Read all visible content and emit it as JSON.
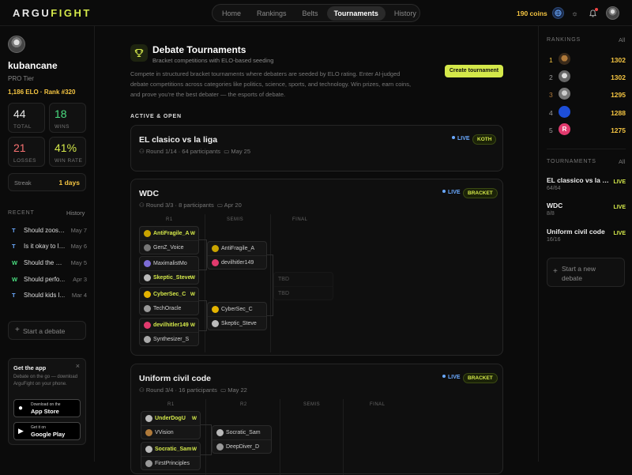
{
  "app": {
    "logo_a": "ARGU",
    "logo_b": "FIGHT"
  },
  "nav": {
    "items": [
      "Home",
      "Rankings",
      "Belts",
      "Tournaments",
      "History"
    ],
    "active": "Tournaments"
  },
  "top": {
    "coins": "190 coins"
  },
  "profile": {
    "username": "kubancane",
    "tier": "PRO Tier",
    "elo": "1,186 ELO",
    "sep": "·",
    "rank": "Rank #320",
    "stats": [
      {
        "value": "44",
        "label": "TOTAL",
        "color": "#e6e6e6"
      },
      {
        "value": "18",
        "label": "WINS",
        "color": "#4ade80"
      },
      {
        "value": "21",
        "label": "LOSSES",
        "color": "#f87171"
      },
      {
        "value": "41%",
        "label": "WIN RATE",
        "color": "#d4e84a"
      }
    ],
    "streak_label": "Streak",
    "streak_value": "1 days"
  },
  "recent": {
    "title": "RECENT",
    "link": "History",
    "items": [
      {
        "k": "T",
        "kcolor": "#6aa9ff",
        "title": "Should zoos…",
        "date": "May 7"
      },
      {
        "k": "T",
        "kcolor": "#6aa9ff",
        "title": "Is it okay to l…",
        "date": "May 6"
      },
      {
        "k": "W",
        "kcolor": "#4ade80",
        "title": "Should the …",
        "date": "May 5"
      },
      {
        "k": "W",
        "kcolor": "#4ade80",
        "title": "Should perfo…",
        "date": "Apr 3"
      },
      {
        "k": "T",
        "kcolor": "#6aa9ff",
        "title": "Should kids l…",
        "date": "Mar 4"
      }
    ]
  },
  "start_debate": "Start a debate",
  "getapp": {
    "title": "Get the app",
    "close": "×",
    "desc": "Debate on the go — download ArguFight on your phone.",
    "appstore_small": "Download on the",
    "appstore": "App Store",
    "gplay_small": "Get it on",
    "gplay": "Google Play"
  },
  "header": {
    "title": "Debate Tournaments",
    "subtitle": "Bracket competitions with ELO-based seeding",
    "create": "Create tournament",
    "desc": "Compete in structured bracket tournaments where debaters are seeded by ELO rating. Enter AI-judged debate competitions across categories like politics, science, sports, and technology. Win prizes, earn coins, and prove you're the best debater — the esports of debate.",
    "section": "ACTIVE & OPEN"
  },
  "tournaments": [
    {
      "title": "EL clasico vs la liga",
      "meta": "Round 1/14 · 64 participants",
      "date": "May 25",
      "status": "LIVE",
      "type": "KOTH"
    },
    {
      "title": "WDC",
      "meta": "Round 3/3 · 8 participants",
      "date": "Apr 20",
      "status": "LIVE",
      "type": "BRACKET",
      "rounds": [
        "R1",
        "SEMIS",
        "FINAL"
      ],
      "r1": [
        [
          {
            "name": "AntiFragile_A",
            "win": true
          },
          {
            "name": "GenZ_Voice",
            "win": false
          }
        ],
        [
          {
            "name": "MaximalistMo",
            "win": false
          },
          {
            "name": "Skeptic_Steve",
            "win": true
          }
        ],
        [
          {
            "name": "CyberSec_C",
            "win": true
          },
          {
            "name": "TechOracle",
            "win": false
          }
        ],
        [
          {
            "name": "devilhitler149",
            "win": true
          },
          {
            "name": "Synthesizer_S",
            "win": false
          }
        ]
      ],
      "semis": [
        [
          {
            "name": "AntiFragile_A"
          },
          {
            "name": "devilhitler149"
          }
        ],
        [
          {
            "name": "CyberSec_C"
          },
          {
            "name": "Skeptic_Steve"
          }
        ]
      ],
      "final": [
        "TBD",
        "TBD"
      ],
      "w": "W"
    },
    {
      "title": "Uniform civil code",
      "meta": "Round 3/4 · 16 participants",
      "date": "May 22",
      "status": "LIVE",
      "type": "BRACKET",
      "rounds": [
        "R1",
        "R2",
        "SEMIS",
        "FINAL"
      ],
      "r1": [
        [
          {
            "name": "UnderDogU",
            "win": true
          },
          {
            "name": "VVision",
            "win": false
          }
        ],
        [
          {
            "name": "Socratic_Sam",
            "win": true
          },
          {
            "name": "FirstPrinciples",
            "win": false
          }
        ]
      ],
      "r2": [
        [
          {
            "name": "Socratic_Sam"
          },
          {
            "name": "DeepDiver_D"
          }
        ]
      ]
    }
  ],
  "rankings": {
    "title": "RANKINGS",
    "link": "All",
    "items": [
      {
        "pos": "1",
        "elo": "1302",
        "poscolor": "#f5c542"
      },
      {
        "pos": "2",
        "elo": "1302",
        "poscolor": "#9a9a9a"
      },
      {
        "pos": "3",
        "elo": "1295",
        "poscolor": "#b07a3a"
      },
      {
        "pos": "4",
        "elo": "1288",
        "poscolor": "#9a9a9a"
      },
      {
        "pos": "5",
        "elo": "1275",
        "poscolor": "#9a9a9a",
        "letter": "R"
      }
    ]
  },
  "side_tournaments": {
    "title": "TOURNAMENTS",
    "link": "All",
    "items": [
      {
        "name": "EL classico vs la li…",
        "count": "64/64",
        "status": "LIVE"
      },
      {
        "name": "WDC",
        "count": "8/8",
        "status": "LIVE"
      },
      {
        "name": "Uniform civil code",
        "count": "16/16",
        "status": "LIVE"
      }
    ]
  },
  "start_new": {
    "plus": "+",
    "label": "Start a new debate"
  },
  "colors": {
    "accent": "#d4e84a",
    "gold": "#f5c542",
    "live": "#6aa9ff"
  }
}
